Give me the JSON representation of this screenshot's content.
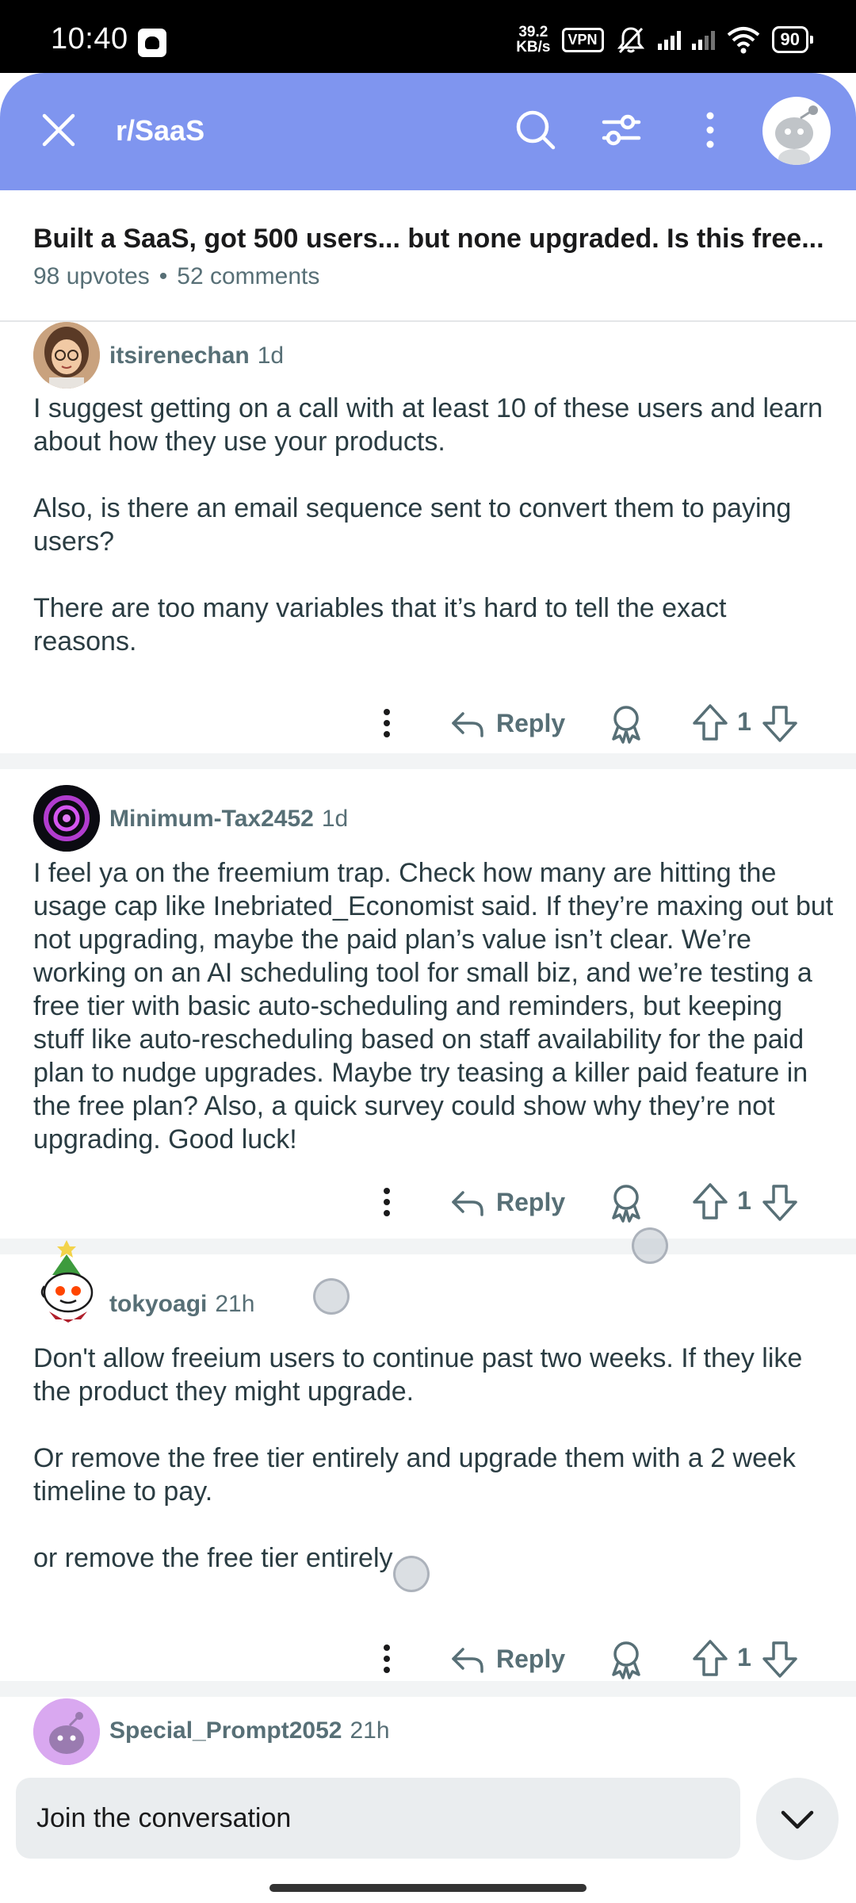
{
  "status_bar": {
    "time": "10:40",
    "net_speed_value": "39.2",
    "net_speed_unit": "KB/s",
    "vpn": "VPN",
    "battery": "90",
    "icons": [
      "app-notification-icon",
      "mute-bell-icon",
      "signal-icon",
      "signal-icon",
      "wifi-icon",
      "battery-icon"
    ]
  },
  "header": {
    "title": "r/SaaS",
    "background": "#7f95ef",
    "icons": [
      "close-icon",
      "search-icon",
      "filter-icon",
      "more-vertical-icon",
      "avatar"
    ]
  },
  "post": {
    "title": "Built a SaaS, got 500 users... but none upgraded. Is this free...",
    "upvotes": "98 upvotes",
    "separator": "•",
    "comments": "52 comments"
  },
  "comments": [
    {
      "author": "itsirenechan",
      "age": "1d",
      "paragraphs": [
        "I suggest getting on a call with at least 10 of these users and learn about how they use your products.",
        "Also, is there an email sequence sent to convert them to paying users?",
        "There are too many variables that it’s hard to tell the exact reasons."
      ],
      "reply_label": "Reply",
      "score": "1"
    },
    {
      "author": "Minimum-Tax2452",
      "age": "1d",
      "paragraphs": [
        "I feel ya on the freemium trap. Check how many are hitting the usage cap like Inebriated_Economist said. If they’re maxing out but not upgrading, maybe the paid plan’s value isn’t clear. We’re working on an AI scheduling tool for small biz, and we’re testing a free tier with basic auto-scheduling and reminders, but keeping stuff like auto-rescheduling based on staff availability for the paid plan to nudge upgrades. Maybe try teasing a killer paid feature in the free plan? Also, a quick survey could show why they’re not upgrading. Good luck!"
      ],
      "reply_label": "Reply",
      "score": "1"
    },
    {
      "author": "tokyoagi",
      "age": "21h",
      "paragraphs": [
        "Don't allow freeium users to continue past two weeks. If they like the product they might upgrade.",
        "Or remove the free tier entirely and upgrade them with a 2 week timeline to pay.",
        "or remove the free tier entirely"
      ],
      "reply_label": "Reply",
      "score": "1"
    },
    {
      "author": "Special_Prompt2052",
      "age": "21h"
    }
  ],
  "composer": {
    "placeholder": "Join the conversation"
  }
}
